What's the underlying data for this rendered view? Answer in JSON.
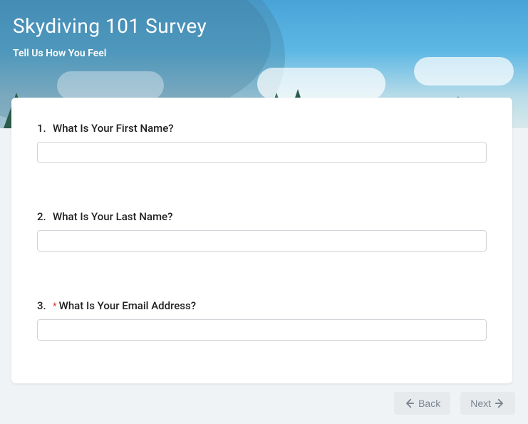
{
  "header": {
    "title": "Skydiving 101 Survey",
    "subtitle": "Tell Us How You Feel"
  },
  "questions": [
    {
      "number": "1.",
      "label": "What Is Your First Name?",
      "required": false,
      "value": ""
    },
    {
      "number": "2.",
      "label": "What Is Your Last Name?",
      "required": false,
      "value": ""
    },
    {
      "number": "3.",
      "label": "What Is Your Email Address?",
      "required": true,
      "value": ""
    }
  ],
  "buttons": {
    "back": "Back",
    "next": "Next"
  }
}
